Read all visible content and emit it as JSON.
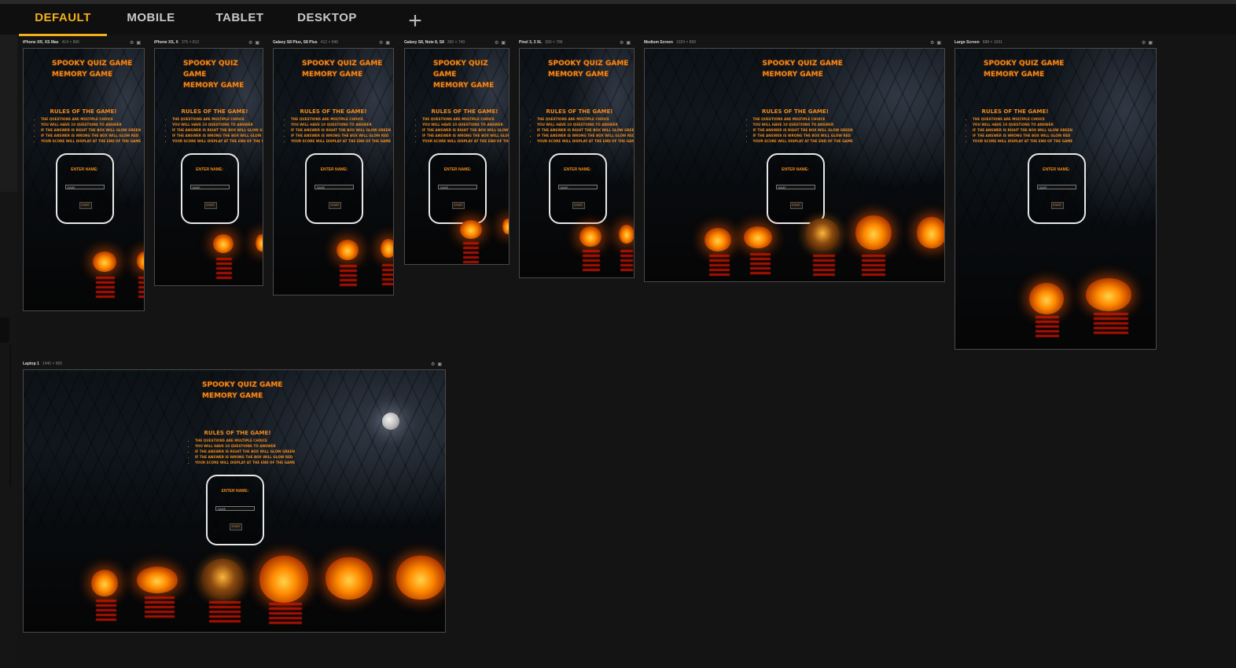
{
  "tabs": [
    {
      "label": "DEFAULT"
    },
    {
      "label": "MOBILE"
    },
    {
      "label": "TABLET"
    },
    {
      "label": "DESKTOP"
    }
  ],
  "add_icon": "plus-icon",
  "accent_color": "#f2b01e",
  "page_text_color": "#f08a1c",
  "preview": {
    "title_line1": "SPOOKY QUIZ GAME",
    "title_line2": "MEMORY GAME",
    "rules_heading": "RULES OF THE GAME!",
    "rules": [
      "THE QUESTIONS ARE MULTIPLE CHOICE",
      "YOU WILL HAVE 10 QUESTIONS TO ANSWER",
      "IF THE ANSWER IS RIGHT THE BOX WILL GLOW GREEN",
      "IF THE ANSWER IS WRONG THE BOX WILL GLOW RED",
      "YOUR SCORE WILL DISPLAY AT THE END OF THE GAME"
    ],
    "name_label": "ENTER NAME:",
    "name_placeholder": "NAME",
    "start_label": "START"
  },
  "devices": [
    {
      "name": "iPhone XR, XS Max",
      "size": "414 × 896"
    },
    {
      "name": "iPhone XS, X",
      "size": "375 × 812"
    },
    {
      "name": "Galaxy S8 Plus, S8 Plus",
      "size": "412 × 846"
    },
    {
      "name": "Galaxy S8, Note 8, S8",
      "size": "360 × 740"
    },
    {
      "name": "Pixel 3, 3 XL",
      "size": "393 × 786"
    },
    {
      "name": "Medium Screen",
      "size": "1024 × 800"
    },
    {
      "name": "Large Screen",
      "size": "688 × 1031"
    },
    {
      "name": "Laptop 1",
      "size": "1440 × 900"
    }
  ]
}
